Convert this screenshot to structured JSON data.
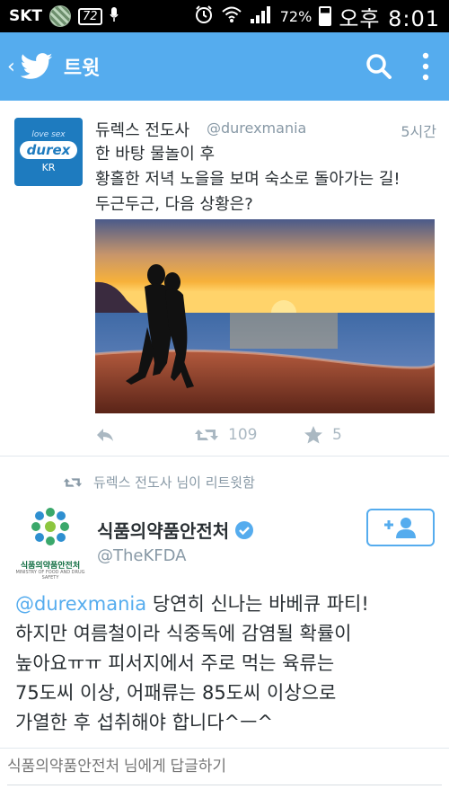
{
  "status_bar": {
    "carrier": "SKT",
    "notification_count": "72",
    "battery_percent": "72%",
    "time": "오후 8:01"
  },
  "header": {
    "title": "트윗",
    "accent_color": "#55acee"
  },
  "tweet": {
    "author_name": "듀렉스 전도사",
    "author_handle": "@durexmania",
    "time_ago": "5시간",
    "avatar_top": "love sex",
    "avatar_logo": "durex",
    "avatar_kr": "KR",
    "lines": [
      "한 바탕 물놀이 후",
      "황홀한 저녁 노을을 보며 숙소로 돌아가는 길!",
      "두근두근, 다음 상황은?"
    ],
    "retweet_count": "109",
    "favorite_count": "5"
  },
  "retweet_notice": "듀렉스 전도사 님이 리트윗함",
  "reply_tweet": {
    "author_name": "식품의약품안전처",
    "author_handle": "@TheKFDA",
    "avatar_label": "식품의약품안전처",
    "avatar_sub": "MINISTRY OF FOOD AND DRUG SAFETY",
    "mention": "@durexmania",
    "line1_rest": " 당연히 신나는 바베큐 파티!",
    "lines": [
      "하지만 여름철이라 식중독에 감염될 확률이",
      "높아요ㅠㅠ 피서지에서 주로 먹는 육류는",
      "75도씨 이상, 어패류는 85도씨 이상으로",
      "가열한 후 섭취해야 합니다^ㅡ^"
    ]
  },
  "reply_bar": {
    "placeholder": "식품의약품안전처 님에게 답글하기"
  }
}
